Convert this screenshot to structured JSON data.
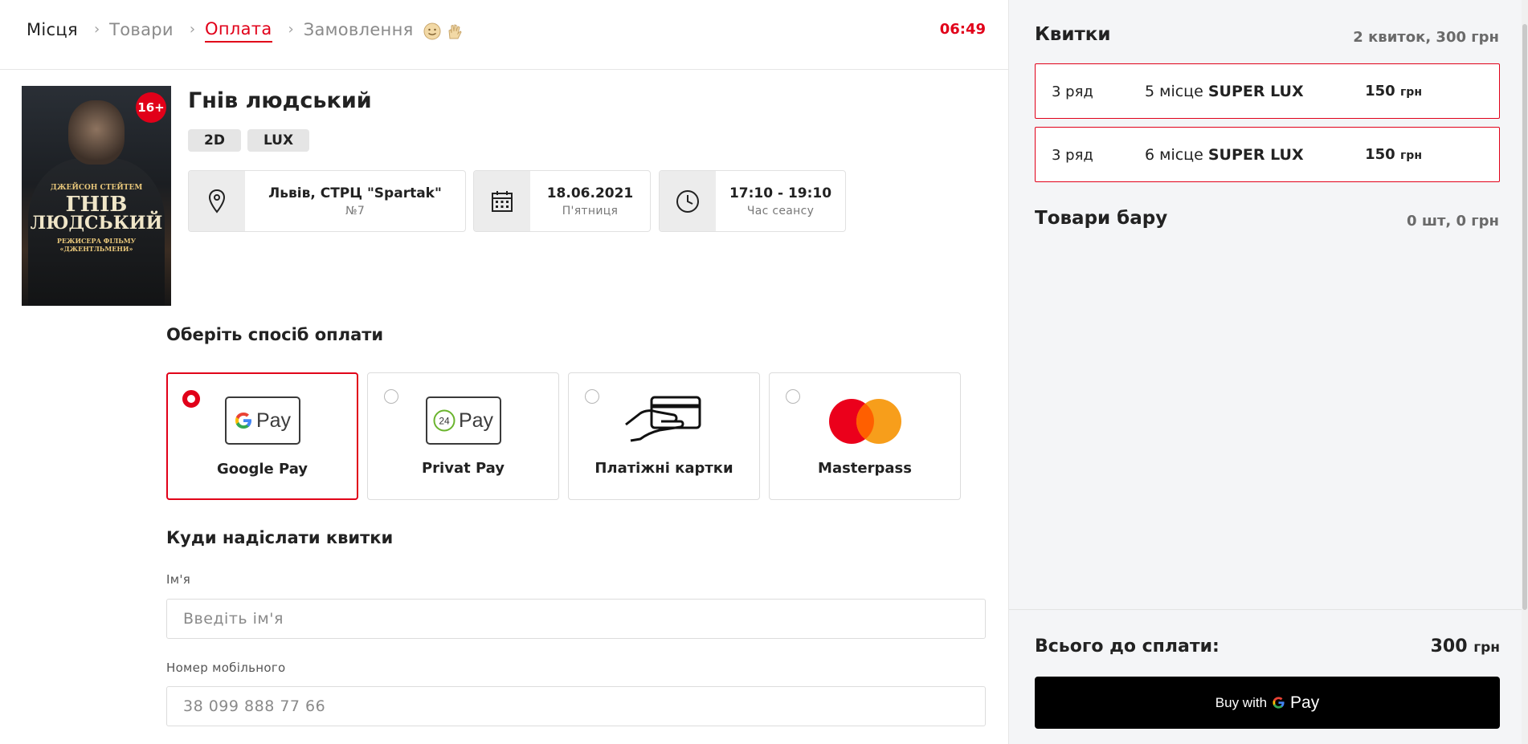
{
  "breadcrumbs": {
    "steps": [
      "Місця",
      "Товари",
      "Оплата",
      "Замовлення"
    ],
    "timer": "06:49"
  },
  "film": {
    "title": "Гнів людський",
    "age": "16+",
    "formats": [
      "2D",
      "LUX"
    ],
    "poster_text": {
      "actor": "ДЖЕЙСОН СТЕЙТЕМ",
      "title_line1": "ГНІВ",
      "title_line2": "ЛЮДСЬКИЙ",
      "director": "РЕЖИСЕРА ФІЛЬМУ «ДЖЕНТЛЬМЕНИ»"
    },
    "location": {
      "main": "Львів, СТРЦ \"Spartak\"",
      "sub": "№7"
    },
    "date": {
      "main": "18.06.2021",
      "sub": "П'ятниця"
    },
    "time": {
      "main": "17:10 - 19:10",
      "sub": "Час сеансу"
    }
  },
  "payment": {
    "title": "Оберіть спосіб оплати",
    "methods": [
      {
        "label": "Google Pay",
        "selected": true,
        "logo_text": "Pay"
      },
      {
        "label": "Privat Pay",
        "selected": false,
        "logo_text": "Pay",
        "badge": "24"
      },
      {
        "label": "Платіжні картки",
        "selected": false
      },
      {
        "label": "Masterpass",
        "selected": false
      }
    ]
  },
  "delivery": {
    "title": "Куди надіслати квитки",
    "name_label": "Ім'я",
    "name_placeholder": "Введіть ім'я",
    "phone_label": "Номер мобільного",
    "phone_placeholder": "38 099 888 77 66"
  },
  "sidebar": {
    "tickets_title": "Квитки",
    "tickets_summary": "2 квиток, 300 грн",
    "tickets": [
      {
        "row": "3 ряд",
        "seat": "5 місце",
        "hall": "SUPER LUX",
        "price": "150",
        "currency": "грн"
      },
      {
        "row": "3 ряд",
        "seat": "6 місце",
        "hall": "SUPER LUX",
        "price": "150",
        "currency": "грн"
      }
    ],
    "bar_title": "Товари бару",
    "bar_summary": "0 шт, 0 грн",
    "total_label": "Всього до сплати:",
    "total_value": "300",
    "total_currency": "грн",
    "buy_prefix": "Buy with",
    "buy_pay": "Pay"
  },
  "colors": {
    "accent": "#e10019",
    "mastercard_red": "#eb001b",
    "mastercard_orange": "#f79e1b"
  }
}
